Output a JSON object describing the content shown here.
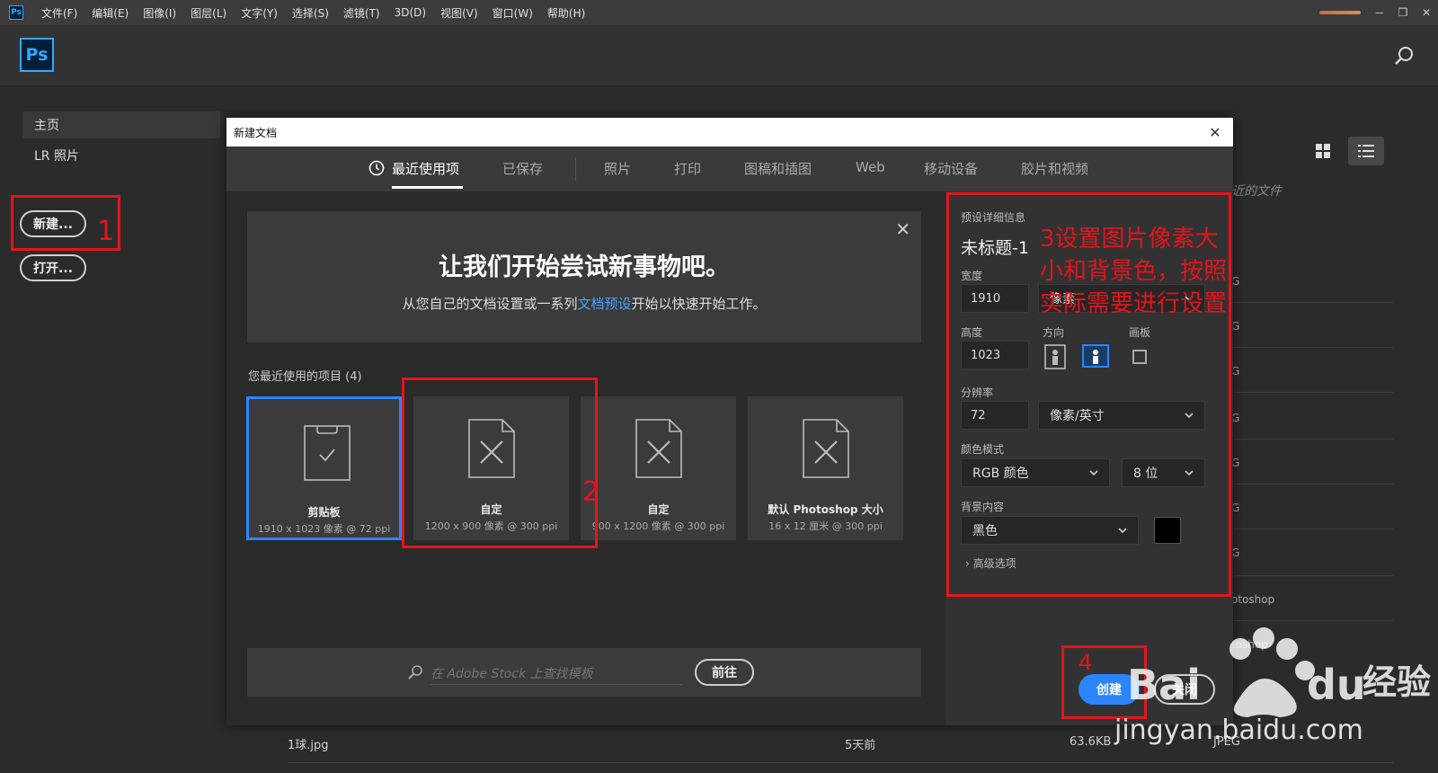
{
  "menubar": {
    "items": [
      "文件(F)",
      "编辑(E)",
      "图像(I)",
      "图层(L)",
      "文字(Y)",
      "选择(S)",
      "滤镜(T)",
      "3D(D)",
      "视图(V)",
      "窗口(W)",
      "帮助(H)"
    ],
    "icon": "ps-app-icon",
    "controls": [
      "－",
      "❐",
      "✕"
    ]
  },
  "header": {
    "logo_text": "Ps",
    "search_icon": "search-icon"
  },
  "sidebar": {
    "items": [
      {
        "label": "主页"
      },
      {
        "label": "LR 照片"
      }
    ],
    "new_button": "新建...",
    "open_button": "打开..."
  },
  "background": {
    "recent_files_label": "近的文件",
    "fragments": [
      "G",
      "G",
      "G",
      "G",
      "G",
      "G",
      "G",
      "otoshop",
      "toshop"
    ],
    "bottom_row": {
      "name": "1球.jpg",
      "modified": "5天前",
      "size": "63.6KB",
      "type": "JPEG"
    }
  },
  "dialog": {
    "title": "新建文档",
    "close_icon": "close-icon",
    "tabs": [
      {
        "label": "最近使用项",
        "active": true
      },
      {
        "label": "已保存",
        "active": false
      },
      {
        "label": "照片",
        "active": false
      },
      {
        "label": "打印",
        "active": false
      },
      {
        "label": "图稿和插图",
        "active": false
      },
      {
        "label": "Web",
        "active": false
      },
      {
        "label": "移动设备",
        "active": false
      },
      {
        "label": "胶片和视频",
        "active": false
      }
    ],
    "welcome": {
      "title": "让我们开始尝试新事物吧。",
      "sub_before": "从您自己的文档设置或一系列",
      "sub_link": "文档预设",
      "sub_after": "开始以快速开始工作。"
    },
    "recent": {
      "label": "您最近使用的项目",
      "count": "(4)",
      "cards": [
        {
          "name": "剪贴板",
          "dimensions": "1910 x 1023 像素 @ 72 ppi",
          "icon": "clipboard-icon",
          "selected": true
        },
        {
          "name": "自定",
          "dimensions": "1200 x 900 像素 @ 300 ppi",
          "icon": "custom-document-icon",
          "selected": false
        },
        {
          "name": "自定",
          "dimensions": "900 x 1200 像素 @ 300 ppi",
          "icon": "custom-document-icon",
          "selected": false
        },
        {
          "name": "默认 Photoshop 大小",
          "dimensions": "16 x 12 厘米 @ 300 ppi",
          "icon": "custom-document-icon",
          "selected": false
        }
      ]
    },
    "stock": {
      "placeholder": "在 Adobe Stock 上查找模板",
      "go_button": "前往"
    },
    "preset": {
      "section_label": "预设详细信息",
      "name": "未标题-1",
      "width_label": "宽度",
      "width_value": "1910",
      "width_unit": "像素",
      "height_label": "高度",
      "height_value": "1023",
      "orientation_label": "方向",
      "artboard_label": "画板",
      "resolution_label": "分辨率",
      "resolution_value": "72",
      "resolution_unit": "像素/英寸",
      "color_mode_label": "颜色模式",
      "color_mode": "RGB 颜色",
      "bit_depth": "8 位",
      "background_label": "背景内容",
      "background_value": "黑色",
      "background_color": "#000000",
      "advanced": "高级选项"
    },
    "create_button": "创建",
    "close_button": "关闭"
  },
  "annotations": {
    "num1": "1",
    "num2": "2",
    "num3_text": "3设置图片像素大小和背景色，按照实际需要进行设置",
    "num4": "4",
    "color": "#e3141c"
  },
  "watermark": {
    "brand": "Bai",
    "brand2": "du",
    "label": "经验",
    "url": "jingyan.baidu.com"
  }
}
